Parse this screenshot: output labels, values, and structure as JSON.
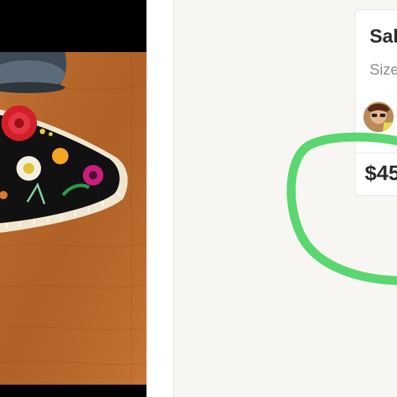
{
  "listing": {
    "title": "Sal",
    "size_label": "Size",
    "price": "$45"
  },
  "colors": {
    "accent_highlight": "#3fd15a",
    "background": "#f7f6f2",
    "card": "#ffffff",
    "text": "#2b2b2b",
    "muted_text": "#8d8d8d"
  },
  "icons": {
    "avatar": "seller-avatar"
  }
}
